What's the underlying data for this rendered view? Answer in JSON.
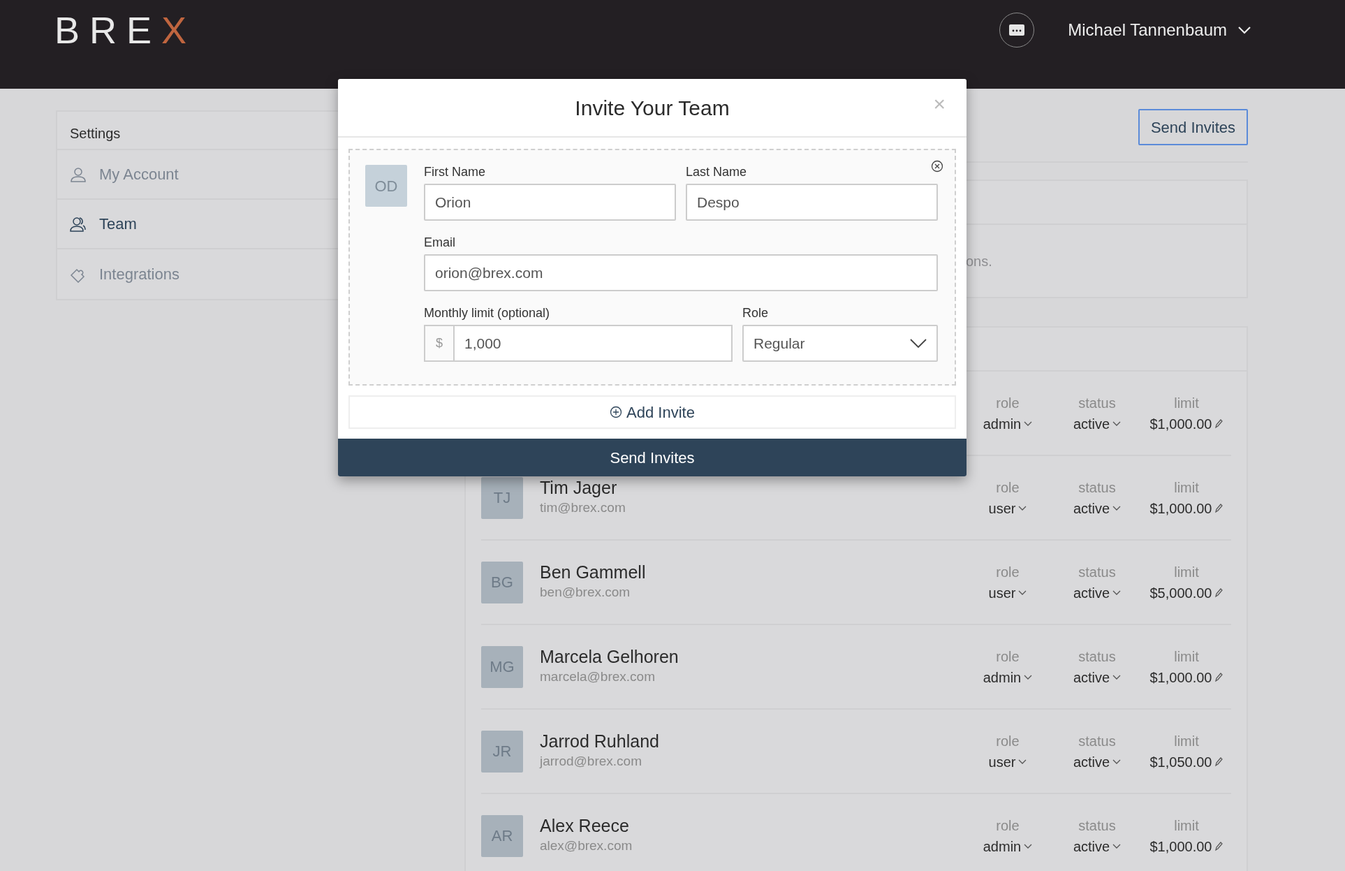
{
  "header": {
    "logo": "BREX",
    "user_name": "Michael Tannenbaum"
  },
  "sidebar": {
    "title": "Settings",
    "items": [
      {
        "label": "My Account",
        "kind": "account",
        "selected": false
      },
      {
        "label": "Team",
        "kind": "team",
        "selected": true
      },
      {
        "label": "Integrations",
        "kind": "integrations",
        "selected": false
      }
    ]
  },
  "toolbar": {
    "send_button": "Send Invites"
  },
  "notice_card": {
    "text": "ons."
  },
  "members": [
    {
      "role_label": "role",
      "role": "admin",
      "status_label": "status",
      "status": "active",
      "limit_label": "limit",
      "limit": "$1,000.00"
    },
    {
      "initials": "TJ",
      "name": "Tim Jager",
      "email": "tim@brex.com",
      "role_label": "role",
      "role": "user",
      "status_label": "status",
      "status": "active",
      "limit_label": "limit",
      "limit": "$1,000.00"
    },
    {
      "initials": "BG",
      "name": "Ben Gammell",
      "email": "ben@brex.com",
      "role_label": "role",
      "role": "user",
      "status_label": "status",
      "status": "active",
      "limit_label": "limit",
      "limit": "$5,000.00"
    },
    {
      "initials": "MG",
      "name": "Marcela Gelhoren",
      "email": "marcela@brex.com",
      "role_label": "role",
      "role": "admin",
      "status_label": "status",
      "status": "active",
      "limit_label": "limit",
      "limit": "$1,000.00"
    },
    {
      "initials": "JR",
      "name": "Jarrod Ruhland",
      "email": "jarrod@brex.com",
      "role_label": "role",
      "role": "user",
      "status_label": "status",
      "status": "active",
      "limit_label": "limit",
      "limit": "$1,050.00"
    },
    {
      "initials": "AR",
      "name": "Alex Reece",
      "email": "alex@brex.com",
      "role_label": "role",
      "role": "admin",
      "status_label": "status",
      "status": "active",
      "limit_label": "limit",
      "limit": "$1,000.00"
    }
  ],
  "modal": {
    "title": "Invite Your Team",
    "close": "×",
    "invites": [
      {
        "initials": "OD",
        "first_name_label": "First Name",
        "first_name": "Orion",
        "last_name_label": "Last Name",
        "last_name": "Despo",
        "email_label": "Email",
        "email": "orion@brex.com",
        "limit_label": "Monthly limit (optional)",
        "currency": "$",
        "limit": "1,000",
        "role_label": "Role",
        "role": "Regular"
      }
    ],
    "add_button": "Add Invite",
    "submit_button": "Send Invites"
  }
}
